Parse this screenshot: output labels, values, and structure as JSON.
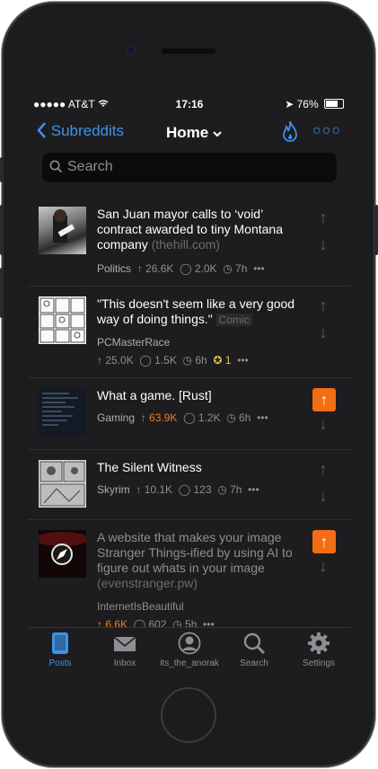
{
  "status": {
    "carrier": "AT&T",
    "time": "17:16",
    "battery": "76%"
  },
  "nav": {
    "back_label": "Subreddits",
    "title": "Home",
    "fire_icon": "flame-icon",
    "more_icon": "more-icon"
  },
  "search": {
    "placeholder": "Search"
  },
  "posts": [
    {
      "title": "San Juan mayor calls to ‘void’ contract awarded to tiny Montana company",
      "domain": "(thehill.com)",
      "subreddit": "Politics",
      "score": "26.6K",
      "comments": "2.0K",
      "age": "7h",
      "voted": false
    },
    {
      "title": "\"This doesn't seem like a very good way of doing things.\"",
      "flair": "Comic",
      "subreddit": "PCMasterRace",
      "score": "25.0K",
      "comments": "1.5K",
      "age": "6h",
      "gold": "1",
      "voted": false
    },
    {
      "title": "What a game. [Rust]",
      "subreddit": "Gaming",
      "score": "63.9K",
      "comments": "1.2K",
      "age": "6h",
      "voted": true
    },
    {
      "title": "The Silent Witness",
      "subreddit": "Skyrim",
      "score": "10.1K",
      "comments": "123",
      "age": "7h",
      "voted": false
    },
    {
      "title": "A website that makes your image Stranger Things-ified by using AI to figure out whats in your image",
      "domain": "(evenstranger.pw)",
      "subreddit": "InternetIsBeautiful",
      "score": "6.6K",
      "comments": "602",
      "age": "5h",
      "voted": true
    }
  ],
  "tabs": [
    {
      "label": "Posts",
      "active": true
    },
    {
      "label": "Inbox",
      "active": false
    },
    {
      "label": "its_the_anorak",
      "active": false
    },
    {
      "label": "Search",
      "active": false
    },
    {
      "label": "Settings",
      "active": false
    }
  ],
  "colors": {
    "accent": "#3d92ea",
    "upvote": "#f26d13",
    "background": "#1d1d1f"
  }
}
